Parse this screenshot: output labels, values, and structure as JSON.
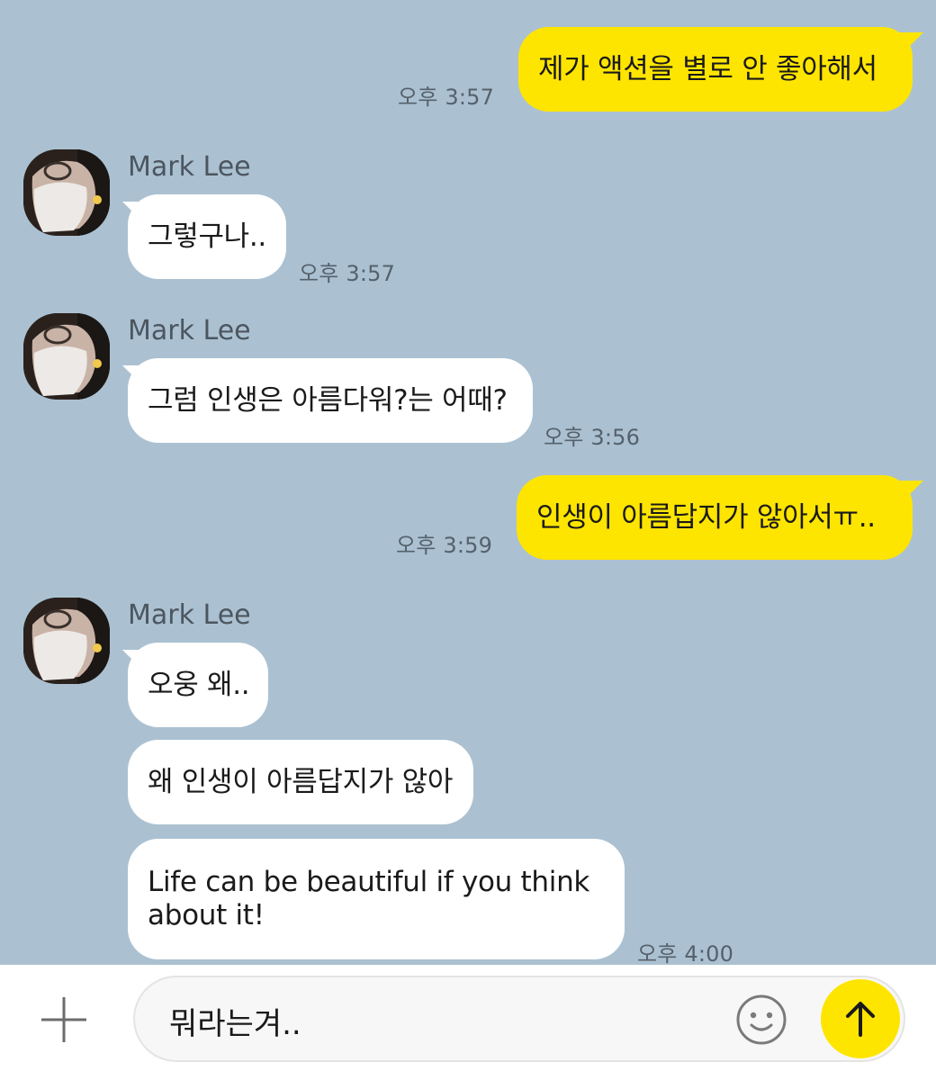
{
  "messages": [
    {
      "side": "me",
      "text": "제가 액션을 별로 안 좋아해서",
      "time": "오후 3:57"
    },
    {
      "side": "other",
      "sender": "Mark Lee",
      "text": "그렇구나..",
      "time": "오후 3:57"
    },
    {
      "side": "other",
      "sender": "Mark Lee",
      "text": "그럼 인생은 아름다워?는 어때?",
      "time": "오후 3:56"
    },
    {
      "side": "me",
      "text": "인생이 아름답지가 않아서ㅠ..",
      "time": "오후 3:59"
    },
    {
      "side": "other",
      "sender": "Mark Lee",
      "text": "오웅 왜.."
    },
    {
      "side": "other",
      "text": "왜 인생이 아름답지가 않아"
    },
    {
      "side": "other",
      "text": "Life can be beautiful if you think about it!",
      "time": "오후 4:00"
    }
  ],
  "composer": {
    "input_value": "뭐라는겨..",
    "plus_icon": "plus-icon",
    "emoji_icon": "emoji-icon",
    "send_icon": "arrow-up-icon"
  },
  "colors": {
    "background": "#abc1d1",
    "my_bubble": "#fee500",
    "other_bubble": "#ffffff",
    "send_button": "#fee500"
  }
}
